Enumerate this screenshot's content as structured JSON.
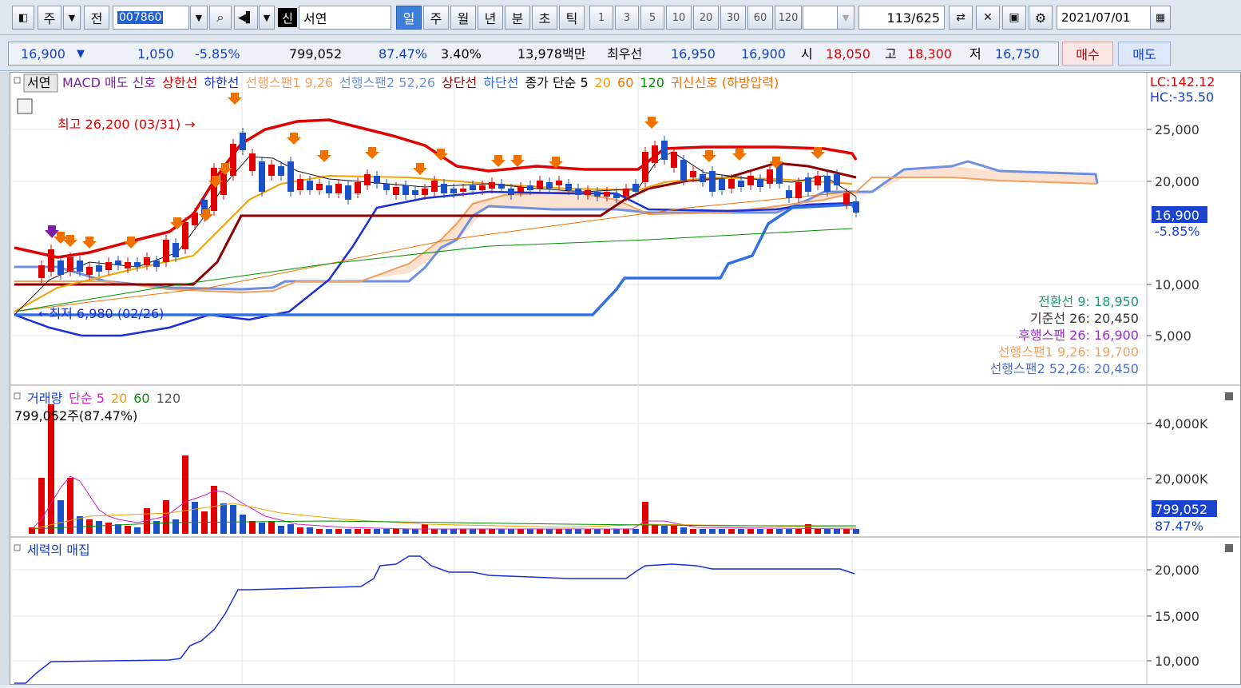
{
  "toolbar": {
    "icon_button": "chart-menu-icon",
    "type_label": "주",
    "prev_label": "전",
    "code_value": "007860",
    "stock_badge": "신",
    "stock_name": "서연",
    "periods": [
      "일",
      "주",
      "월",
      "년",
      "분",
      "초",
      "틱"
    ],
    "active_period": "일",
    "intervals": [
      "1",
      "3",
      "5",
      "10",
      "20",
      "30",
      "60",
      "120"
    ],
    "count_value": "113",
    "count_total": "/625",
    "date_value": "2021/07/01"
  },
  "quote": {
    "price": "16,900",
    "down_arrow": "▼",
    "change": "1,050",
    "change_pct": "-5.85%",
    "volume": "799,052",
    "volume_pct": "87.47%",
    "turnover_pct": "3.40%",
    "amount": "13,978백만",
    "best_label": "최우선",
    "best_ask": "16,950",
    "best_bid": "16,900",
    "open_label": "시",
    "open": "18,050",
    "high_label": "고",
    "high": "18,300",
    "low_label": "저",
    "low": "16,750",
    "buy_label": "매수",
    "sell_label": "매도"
  },
  "main_chart": {
    "name_tag": "서연",
    "legend": [
      {
        "text": "MACD 매도 신호",
        "color": "#7a1fa2"
      },
      {
        "text": "상한선",
        "color": "#e00000"
      },
      {
        "text": "하한선",
        "color": "#1a2fd6"
      },
      {
        "text": "선행스팬1 9,26",
        "color": "#f0a060"
      },
      {
        "text": "선행스팬2 52,26",
        "color": "#6f8fdf"
      },
      {
        "text": "상단선",
        "color": "#8b0000"
      },
      {
        "text": "하단선",
        "color": "#3070e0"
      },
      {
        "text": "종가 단순 5",
        "color": "#000000"
      },
      {
        "text": "20",
        "color": "#f0a000"
      },
      {
        "text": "60",
        "color": "#f07000"
      },
      {
        "text": "120",
        "color": "#009000"
      },
      {
        "text": "귀신신호 (하방압력)",
        "color": "#f07000"
      }
    ],
    "lc": "LC:142.12",
    "hc": "HC:-35.50",
    "high_note": "최고 26,200 (03/31) →",
    "low_note": "←최저 6,980 (02/26)",
    "y_ticks": [
      "25,000",
      "20,000",
      "10,000",
      "5,000"
    ],
    "price_tag": "16,900",
    "pct_tag": "-5.85%",
    "ichimoku": [
      {
        "text": "전환선 9: 18,950",
        "color": "#1a9a70"
      },
      {
        "text": "기준선 26: 20,450",
        "color": "#333333"
      },
      {
        "text": "후행스팬 26: 16,900",
        "color": "#9a2ad0"
      },
      {
        "text": "선행스팬1 9,26: 19,700",
        "color": "#f0a060"
      },
      {
        "text": "선행스팬2 52,26: 20,450",
        "color": "#4a6fd0"
      }
    ]
  },
  "volume_chart": {
    "legend": [
      {
        "text": "거래량",
        "color": "#1a40c8"
      },
      {
        "text": "단순 5",
        "color": "#d020c0"
      },
      {
        "text": "20",
        "color": "#f0a000"
      },
      {
        "text": "60",
        "color": "#009000"
      },
      {
        "text": "120",
        "color": "#555555"
      }
    ],
    "info": "799,052주(87.47%)",
    "y_ticks": [
      "40,000K",
      "20,000K"
    ],
    "vol_tag": "799,052",
    "pct_tag": "87.47%"
  },
  "power_chart": {
    "title": "세력의 매집",
    "y_ticks": [
      "20,000",
      "15,000",
      "10,000"
    ]
  }
}
